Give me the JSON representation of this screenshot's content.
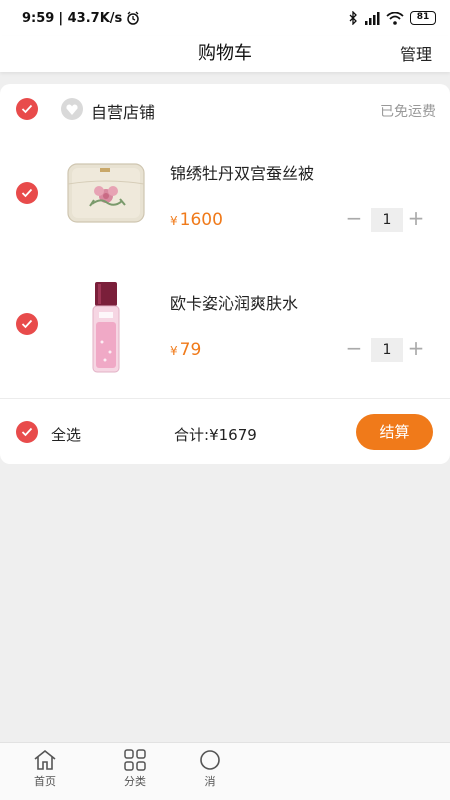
{
  "status_bar": {
    "time": "9:59",
    "speed": "| 43.7K/s",
    "battery": "81"
  },
  "header": {
    "title": "购物车",
    "manage": "管理"
  },
  "store": {
    "name": "自营店铺",
    "shipping": "已免运费"
  },
  "items": [
    {
      "name": "锦绣牡丹双宫蚕丝被",
      "currency": "¥",
      "price": "1600",
      "quantity": "1",
      "minus": "−",
      "plus": "+"
    },
    {
      "name": "欧卡姿沁润爽肤水",
      "currency": "¥",
      "price": "79",
      "quantity": "1",
      "minus": "−",
      "plus": "+"
    }
  ],
  "footer": {
    "select_all": "全选",
    "total_label": "合计:",
    "total_value": "¥1679",
    "checkout": "结算"
  },
  "tabs": [
    {
      "label": "首页"
    },
    {
      "label": "分类"
    },
    {
      "label": "消"
    }
  ],
  "colors": {
    "accent": "#f07a1a",
    "check": "#e84b4b"
  }
}
